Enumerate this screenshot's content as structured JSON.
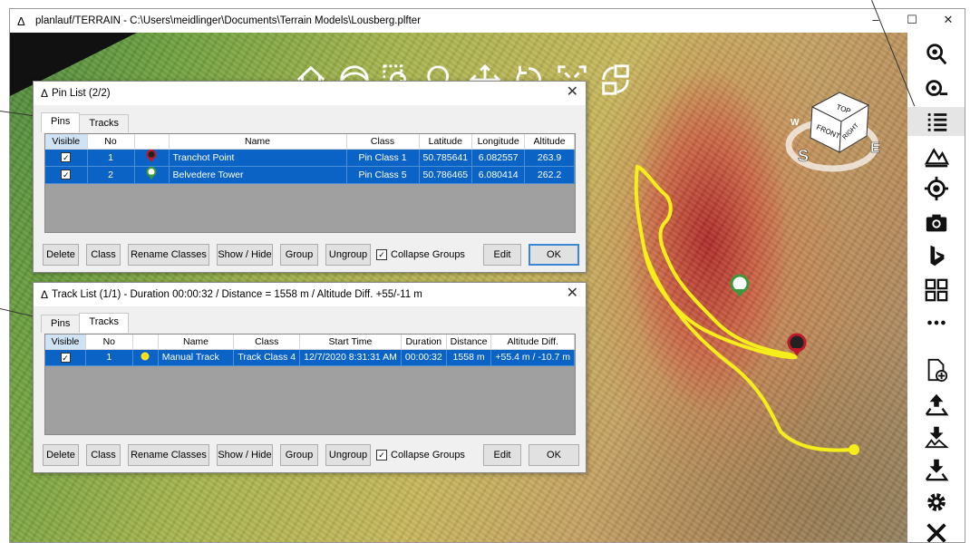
{
  "window": {
    "title": "planlauf/TERRAIN - C:\\Users\\meidlinger\\Documents\\Terrain Models\\Lousberg.plfter",
    "minimize": "–",
    "maximize": "☐",
    "close": "✕",
    "app_icon": "ΔΔ"
  },
  "map_toolbar": [
    "home-icon",
    "orbit-icon",
    "zoom-window-icon",
    "zoom-icon",
    "pan-icon",
    "rotate-icon",
    "zoom-extents-icon",
    "perspective-icon"
  ],
  "view_cube": {
    "top": "TOP",
    "front": "FRONT",
    "right": "RIGHT",
    "south": "S",
    "east": "E",
    "west": "W"
  },
  "sidebar": [
    "search-pin-icon",
    "find-icon",
    "list-icon",
    "terrain-icon",
    "target-icon",
    "camera-icon",
    "bing-icon",
    "grid-icon",
    "more-icon",
    "new-file-icon",
    "upload-icon",
    "download-terrain-icon",
    "download-icon",
    "settings-icon",
    "close-icon"
  ],
  "pin_dialog": {
    "title": "Pin List (2/2)",
    "close": "✕",
    "tabs": [
      "Pins",
      "Tracks"
    ],
    "columns": [
      "Visible",
      "No",
      "",
      "Name",
      "Class",
      "Latitude",
      "Longitude",
      "Altitude"
    ],
    "rows": [
      {
        "visible": "✓",
        "no": "1",
        "pin_color": "#c0182a",
        "name": "Tranchot Point",
        "class": "Pin Class 1",
        "latitude": "50.785641",
        "longitude": "6.082557",
        "altitude": "263.9"
      },
      {
        "visible": "✓",
        "no": "2",
        "pin_color": "#3a9a3a",
        "name": "Belvedere Tower",
        "class": "Pin Class 5",
        "latitude": "50.786465",
        "longitude": "6.080414",
        "altitude": "262.2"
      }
    ],
    "buttons": {
      "delete": "Delete",
      "class": "Class",
      "rename": "Rename Classes",
      "show_hide": "Show / Hide",
      "group": "Group",
      "ungroup": "Ungroup",
      "collapse": "Collapse Groups",
      "edit": "Edit",
      "ok": "OK"
    }
  },
  "track_dialog": {
    "title": "Track List (1/1) - Duration 00:00:32 / Distance = 1558 m / Altitude Diff. +55/-11 m",
    "close": "✕",
    "tabs": [
      "Pins",
      "Tracks"
    ],
    "columns": [
      "Visible",
      "No",
      "",
      "Name",
      "Class",
      "Start Time",
      "Duration",
      "Distance",
      "Altitude Diff."
    ],
    "rows": [
      {
        "visible": "✓",
        "no": "1",
        "dot_color": "#ffe11a",
        "name": "Manual Track",
        "class": "Track Class 4",
        "start_time": "12/7/2020 8:31:31 AM",
        "duration": "00:00:32",
        "distance": "1558 m",
        "altitude_diff": "+55.4 m / -10.7 m"
      }
    ],
    "buttons": {
      "delete": "Delete",
      "class": "Class",
      "rename": "Rename Classes",
      "show_hide": "Show / Hide",
      "group": "Group",
      "ungroup": "Ungroup",
      "collapse": "Collapse Groups",
      "edit": "Edit",
      "ok": "OK"
    }
  },
  "colors": {
    "selection": "#0a63c5",
    "track": "#f5ee1a",
    "pin_red": "#c0182a",
    "pin_green": "#3a9a3a"
  }
}
